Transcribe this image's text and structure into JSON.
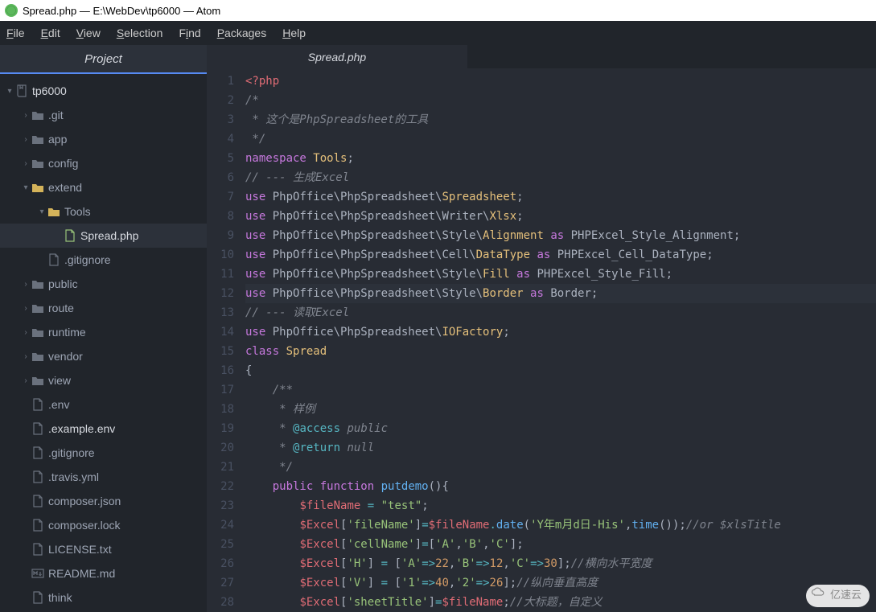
{
  "window": {
    "title": "Spread.php — E:\\WebDev\\tp6000 — Atom"
  },
  "menu": {
    "file": "File",
    "edit": "Edit",
    "view": "View",
    "selection": "Selection",
    "find": "Find",
    "packages": "Packages",
    "help": "Help"
  },
  "sidebar": {
    "header": "Project",
    "root": "tp6000",
    "items": [
      {
        "name": ".git",
        "type": "folder",
        "depth": 1
      },
      {
        "name": "app",
        "type": "folder",
        "depth": 1
      },
      {
        "name": "config",
        "type": "folder",
        "depth": 1
      },
      {
        "name": "extend",
        "type": "folder-open",
        "depth": 1
      },
      {
        "name": "Tools",
        "type": "folder-open",
        "depth": 2
      },
      {
        "name": "Spread.php",
        "type": "file-green",
        "depth": 3,
        "selected": true
      },
      {
        "name": ".gitignore",
        "type": "file",
        "depth": 2
      },
      {
        "name": "public",
        "type": "folder",
        "depth": 1
      },
      {
        "name": "route",
        "type": "folder",
        "depth": 1
      },
      {
        "name": "runtime",
        "type": "folder",
        "depth": 1
      },
      {
        "name": "vendor",
        "type": "folder",
        "depth": 1
      },
      {
        "name": "view",
        "type": "folder",
        "depth": 1
      },
      {
        "name": ".env",
        "type": "file",
        "depth": 1
      },
      {
        "name": ".example.env",
        "type": "file",
        "depth": 1,
        "hl": true
      },
      {
        "name": ".gitignore",
        "type": "file",
        "depth": 1
      },
      {
        "name": ".travis.yml",
        "type": "file",
        "depth": 1
      },
      {
        "name": "composer.json",
        "type": "file",
        "depth": 1
      },
      {
        "name": "composer.lock",
        "type": "file",
        "depth": 1
      },
      {
        "name": "LICENSE.txt",
        "type": "file",
        "depth": 1
      },
      {
        "name": "README.md",
        "type": "file-md",
        "depth": 1
      },
      {
        "name": "think",
        "type": "file",
        "depth": 1
      }
    ]
  },
  "tab": {
    "title": "Spread.php"
  },
  "code": {
    "start": 1,
    "end": 28,
    "highlight": 12,
    "lines": [
      [
        [
          "k-red",
          "<?php"
        ]
      ],
      [
        [
          "k-grey",
          "/*"
        ]
      ],
      [
        [
          "k-grey",
          " * 这个是PhpSpreadsheet的工具"
        ]
      ],
      [
        [
          "k-grey",
          " */"
        ]
      ],
      [
        [
          "k-purple",
          "namespace"
        ],
        [
          "k-white",
          " "
        ],
        [
          "k-yellow",
          "Tools"
        ],
        [
          "k-white",
          ";"
        ]
      ],
      [
        [
          "k-grey",
          "// --- 生成Excel"
        ]
      ],
      [
        [
          "k-purple",
          "use"
        ],
        [
          "k-white",
          " PhpOffice\\PhpSpreadsheet\\"
        ],
        [
          "k-yellow",
          "Spreadsheet"
        ],
        [
          "k-white",
          ";"
        ]
      ],
      [
        [
          "k-purple",
          "use"
        ],
        [
          "k-white",
          " PhpOffice\\PhpSpreadsheet\\Writer\\"
        ],
        [
          "k-yellow",
          "Xlsx"
        ],
        [
          "k-white",
          ";"
        ]
      ],
      [
        [
          "k-purple",
          "use"
        ],
        [
          "k-white",
          " PhpOffice\\PhpSpreadsheet\\Style\\"
        ],
        [
          "k-yellow",
          "Alignment"
        ],
        [
          "k-white",
          " "
        ],
        [
          "k-purple",
          "as"
        ],
        [
          "k-white",
          " PHPExcel_Style_Alignment;"
        ]
      ],
      [
        [
          "k-purple",
          "use"
        ],
        [
          "k-white",
          " PhpOffice\\PhpSpreadsheet\\Cell\\"
        ],
        [
          "k-yellow",
          "DataType"
        ],
        [
          "k-white",
          " "
        ],
        [
          "k-purple",
          "as"
        ],
        [
          "k-white",
          " PHPExcel_Cell_DataType;"
        ]
      ],
      [
        [
          "k-purple",
          "use"
        ],
        [
          "k-white",
          " PhpOffice\\PhpSpreadsheet\\Style\\"
        ],
        [
          "k-yellow",
          "Fill"
        ],
        [
          "k-white",
          " "
        ],
        [
          "k-purple",
          "as"
        ],
        [
          "k-white",
          " PHPExcel_Style_Fill;"
        ]
      ],
      [
        [
          "k-purple",
          "use"
        ],
        [
          "k-white",
          " PhpOffice\\PhpSpreadsheet\\Style\\"
        ],
        [
          "k-yellow",
          "Border"
        ],
        [
          "k-white",
          " "
        ],
        [
          "k-purple",
          "as"
        ],
        [
          "k-white",
          " Border;"
        ]
      ],
      [
        [
          "k-grey",
          "// --- 读取Excel"
        ]
      ],
      [
        [
          "k-purple",
          "use"
        ],
        [
          "k-white",
          " PhpOffice\\PhpSpreadsheet\\"
        ],
        [
          "k-yellow",
          "IOFactory"
        ],
        [
          "k-white",
          ";"
        ]
      ],
      [
        [
          "k-purple",
          "class"
        ],
        [
          "k-white",
          " "
        ],
        [
          "k-yellow",
          "Spread"
        ]
      ],
      [
        [
          "k-white",
          "{"
        ]
      ],
      [
        [
          "k-grey",
          "    /**"
        ]
      ],
      [
        [
          "k-grey",
          "     * 样例"
        ]
      ],
      [
        [
          "k-grey",
          "     * "
        ],
        [
          "k-cyan",
          "@access"
        ],
        [
          "k-grey",
          " public"
        ]
      ],
      [
        [
          "k-grey",
          "     * "
        ],
        [
          "k-cyan",
          "@return"
        ],
        [
          "k-grey",
          " null"
        ]
      ],
      [
        [
          "k-grey",
          "     */"
        ]
      ],
      [
        [
          "k-white",
          "    "
        ],
        [
          "k-purple",
          "public"
        ],
        [
          "k-white",
          " "
        ],
        [
          "k-purple",
          "function"
        ],
        [
          "k-white",
          " "
        ],
        [
          "k-blue",
          "putdemo"
        ],
        [
          "k-white",
          "(){"
        ]
      ],
      [
        [
          "k-white",
          "        "
        ],
        [
          "k-red",
          "$fileName"
        ],
        [
          "k-white",
          " "
        ],
        [
          "k-cyan",
          "="
        ],
        [
          "k-white",
          " "
        ],
        [
          "k-green",
          "\"test\""
        ],
        [
          "k-white",
          ";"
        ]
      ],
      [
        [
          "k-white",
          "        "
        ],
        [
          "k-red",
          "$Excel"
        ],
        [
          "k-white",
          "["
        ],
        [
          "k-green",
          "'fileName'"
        ],
        [
          "k-white",
          "]"
        ],
        [
          "k-cyan",
          "="
        ],
        [
          "k-red",
          "$fileName"
        ],
        [
          "k-cyan",
          "."
        ],
        [
          "k-blue",
          "date"
        ],
        [
          "k-white",
          "("
        ],
        [
          "k-green",
          "'Y年m月d日-His'"
        ],
        [
          "k-white",
          ","
        ],
        [
          "k-blue",
          "time"
        ],
        [
          "k-white",
          "());"
        ],
        [
          "k-grey",
          "//or $xlsTitle"
        ]
      ],
      [
        [
          "k-white",
          "        "
        ],
        [
          "k-red",
          "$Excel"
        ],
        [
          "k-white",
          "["
        ],
        [
          "k-green",
          "'cellName'"
        ],
        [
          "k-white",
          "]"
        ],
        [
          "k-cyan",
          "="
        ],
        [
          "k-white",
          "["
        ],
        [
          "k-green",
          "'A'"
        ],
        [
          "k-white",
          ","
        ],
        [
          "k-green",
          "'B'"
        ],
        [
          "k-white",
          ","
        ],
        [
          "k-green",
          "'C'"
        ],
        [
          "k-white",
          "];"
        ]
      ],
      [
        [
          "k-white",
          "        "
        ],
        [
          "k-red",
          "$Excel"
        ],
        [
          "k-white",
          "["
        ],
        [
          "k-green",
          "'H'"
        ],
        [
          "k-white",
          "] "
        ],
        [
          "k-cyan",
          "="
        ],
        [
          "k-white",
          " ["
        ],
        [
          "k-green",
          "'A'"
        ],
        [
          "k-cyan",
          "=>"
        ],
        [
          "k-orange",
          "22"
        ],
        [
          "k-white",
          ","
        ],
        [
          "k-green",
          "'B'"
        ],
        [
          "k-cyan",
          "=>"
        ],
        [
          "k-orange",
          "12"
        ],
        [
          "k-white",
          ","
        ],
        [
          "k-green",
          "'C'"
        ],
        [
          "k-cyan",
          "=>"
        ],
        [
          "k-orange",
          "30"
        ],
        [
          "k-white",
          "];"
        ],
        [
          "k-grey",
          "//横向水平宽度"
        ]
      ],
      [
        [
          "k-white",
          "        "
        ],
        [
          "k-red",
          "$Excel"
        ],
        [
          "k-white",
          "["
        ],
        [
          "k-green",
          "'V'"
        ],
        [
          "k-white",
          "] "
        ],
        [
          "k-cyan",
          "="
        ],
        [
          "k-white",
          " ["
        ],
        [
          "k-green",
          "'1'"
        ],
        [
          "k-cyan",
          "=>"
        ],
        [
          "k-orange",
          "40"
        ],
        [
          "k-white",
          ","
        ],
        [
          "k-green",
          "'2'"
        ],
        [
          "k-cyan",
          "=>"
        ],
        [
          "k-orange",
          "26"
        ],
        [
          "k-white",
          "];"
        ],
        [
          "k-grey",
          "//纵向垂直高度"
        ]
      ],
      [
        [
          "k-white",
          "        "
        ],
        [
          "k-red",
          "$Excel"
        ],
        [
          "k-white",
          "["
        ],
        [
          "k-green",
          "'sheetTitle'"
        ],
        [
          "k-white",
          "]"
        ],
        [
          "k-cyan",
          "="
        ],
        [
          "k-red",
          "$fileName"
        ],
        [
          "k-white",
          ";"
        ],
        [
          "k-grey",
          "//大标题，自定义"
        ]
      ]
    ]
  },
  "watermark": "亿速云"
}
